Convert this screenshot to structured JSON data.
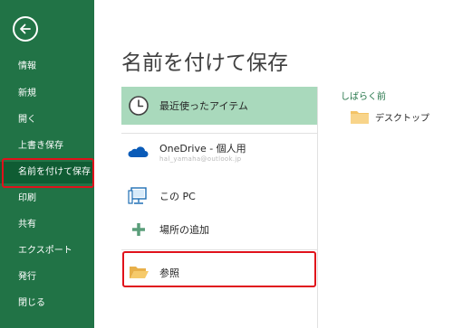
{
  "sidebar": {
    "items": [
      {
        "label": "情報"
      },
      {
        "label": "新規"
      },
      {
        "label": "開く"
      },
      {
        "label": "上書き保存"
      },
      {
        "label": "名前を付けて保存"
      },
      {
        "label": "印刷"
      },
      {
        "label": "共有"
      },
      {
        "label": "エクスポート"
      },
      {
        "label": "発行"
      },
      {
        "label": "閉じる"
      }
    ],
    "selected_index": 4
  },
  "main": {
    "title": "名前を付けて保存",
    "locations": [
      {
        "label": "最近使ったアイテム",
        "icon": "clock-icon"
      },
      {
        "label": "OneDrive - 個人用",
        "sublabel": "hal_yamaha@outlook.jp",
        "icon": "onedrive-cloud-icon"
      },
      {
        "label": "この PC",
        "icon": "computer-icon"
      },
      {
        "label": "場所の追加",
        "icon": "plus-icon"
      },
      {
        "label": "参照",
        "icon": "folder-open-icon"
      }
    ],
    "recent_header": "しばらく前",
    "recent_items": [
      {
        "label": "デスクトップ",
        "icon": "folder-icon"
      }
    ]
  },
  "colors": {
    "sidebar_bg": "#217346",
    "sidebar_selected": "#0f5c33",
    "active_location_bg": "#a9d9bc",
    "highlight_red": "#e0121b"
  }
}
